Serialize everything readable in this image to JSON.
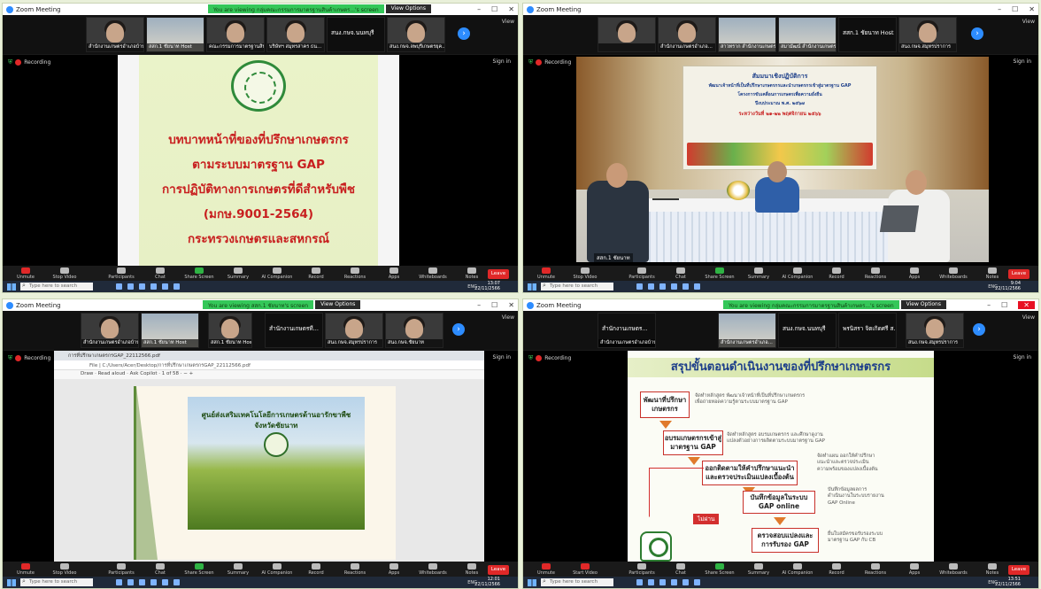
{
  "app_title": "Zoom Meeting",
  "windows": [
    {
      "banner": "You are viewing กลุ่มคณะกรรมการมาตรฐานสินค้าเกษตร...'s screen",
      "view_options": "View Options",
      "tiles": [
        {
          "name": "สำนักงานเกษตรอำเภอบ้าน..."
        },
        {
          "name": "สสก.1 ชัยนาท Host"
        },
        {
          "name": "คณะกรรมการมาตรฐานสินค้า..."
        },
        {
          "name": "บริษัทฯ สมุทรสาคร ธน..."
        },
        {
          "name": "สนง.กษจ.นนทบุรี",
          "label": "สนง.กษจ.นนทบุรี"
        },
        {
          "name": "สนง.กษจ.ลพบุรีเกษตรยุค..."
        }
      ],
      "view": "View",
      "recording": "Recording",
      "sign_in": "Sign in",
      "slide": {
        "line1": "บทบาทหน้าที่ของที่ปรึกษาเกษตรกร",
        "line2": "ตามระบบมาตรฐาน GAP",
        "line3": "การปฏิบัติทางการเกษตรที่ดีสำหรับพืช",
        "line4": "(มกษ.9001-2564)",
        "line5": "กระทรวงเกษตรและสหกรณ์"
      },
      "toolbar": {
        "unmute": "Unmute",
        "stop_video": "Stop Video",
        "participants": "Participants",
        "participants_count": "33",
        "chat": "Chat",
        "share": "Share Screen",
        "summary": "Summary",
        "ai": "AI Companion",
        "record": "Record",
        "reactions": "Reactions",
        "apps": "Apps",
        "whiteboards": "Whiteboards",
        "notes": "Notes",
        "leave": "Leave"
      },
      "taskbar": {
        "search": "Type here to search",
        "time": "13:07",
        "date": "22/11/2566",
        "lang": "ENG"
      }
    },
    {
      "tiles": [
        {
          "name": ""
        },
        {
          "name": "สำนักงานเกษตรอำเภอ..."
        },
        {
          "name": "สาวทราก สำนักงานเกษตร..."
        },
        {
          "name": "สมามัฒน์ สำนักงานเกษตรจังหวัดปทุม"
        },
        {
          "name": "สสก.1 ชัยนาท Host",
          "label": "สสก.1 ชัยนาท Host"
        },
        {
          "name": "สนง.กษจ.สมุทรปราการ"
        }
      ],
      "view": "View",
      "recording": "Recording",
      "sign_in": "Sign in",
      "photo": {
        "banner_line1": "สัมมนาเชิงปฏิบัติการ",
        "banner_line2": "พัฒนาเจ้าหน้าที่เป็นที่ปรึกษาเกษตรกรและนำเกษตรกรเข้าสู่มาตรฐาน GAP",
        "banner_line3": "โครงการขับเคลื่อนการเกษตรเพื่อความยั่งยืน",
        "banner_line4": "ปีงบประมาณ พ.ศ. ๒๕๖๗",
        "banner_line5": "ระหว่างวันที่ ๒๑-๒๒ พฤศจิกายน ๒๕๖๖",
        "nameplate": "สสก.1 ชัยนาท"
      },
      "toolbar": {
        "unmute": "Unmute",
        "stop_video": "Stop Video",
        "participants": "Participants",
        "participants_count": "29",
        "chat": "Chat",
        "share": "Share Screen",
        "summary": "Summary",
        "ai": "AI Companion",
        "record": "Record",
        "reactions": "Reactions",
        "apps": "Apps",
        "whiteboards": "Whiteboards",
        "notes": "Notes",
        "leave": "Leave"
      },
      "taskbar": {
        "search": "Type here to search",
        "time": "9:04",
        "date": "22/11/2566",
        "lang": "ENG"
      }
    },
    {
      "banner": "You are viewing สสก.1 ชัยนาท's screen",
      "view_options": "View Options",
      "tiles": [
        {
          "name": "สำนักงานเกษตรอำเภอบ้าน..."
        },
        {
          "name": "สสก.1 ชัยนาท Host"
        },
        {
          "name": "สสก.1 ชัยนาท Host"
        },
        {
          "name": "สำนักงานเกษตรจังหวัด...",
          "label": "สำนักงานเกษตรที..."
        },
        {
          "name": "สนง.กษจ.สมุทรปราการ"
        },
        {
          "name": "สนง.กษจ.ชัยนาท"
        }
      ],
      "view": "View",
      "recording": "Recording",
      "sign_in": "Sign in",
      "pdf": {
        "tab": "การที่ปรึกษาเกษตรกรGAP_22112566.pdf",
        "url": "File | C:/Users/Acer/Desktop/การที่ปรึกษาเกษตรกรGAP_22112566.pdf",
        "tools": "Draw  ·  Read aloud  ·  Ask Copilot  ·  1 of 58  ·  −  +",
        "page_title1": "ศูนย์ส่งเสริมเทคโนโลยีการเกษตรด้านอารักขาพืช",
        "page_title2": "จังหวัดชัยนาท"
      },
      "toolbar": {
        "unmute": "Unmute",
        "stop_video": "Stop Video",
        "participants": "Participants",
        "participants_count": "31",
        "chat": "Chat",
        "share": "Share Screen",
        "summary": "Summary",
        "ai": "AI Companion",
        "record": "Record",
        "reactions": "Reactions",
        "apps": "Apps",
        "whiteboards": "Whiteboards",
        "notes": "Notes",
        "leave": "Leave"
      },
      "taskbar": {
        "search": "Type here to search",
        "time": "12:01",
        "date": "22/11/2566",
        "lang": "ENG"
      }
    },
    {
      "banner": "You are viewing กลุ่มคณะกรรมการมาตรฐานสินค้าเกษตร...'s screen",
      "view_options": "View Options",
      "tiles": [
        {
          "name": "สำนักงานเกษตรอำเภอบ้าน...",
          "label": "สำนักงานเกษตร..."
        },
        {
          "name": "สำนักงานเกษตรอำเภอ..."
        },
        {
          "name": "สนง.กษจ.นนทบุรี",
          "label": "สนง.กษจ.นนทบุรี"
        },
        {
          "name": "สนง.กษจ.ลพบุรี",
          "label": "พรนิสรา จิตเกิดศรี ส..."
        },
        {
          "name": "สนง.กษจ.สมุทรปราการ"
        }
      ],
      "view": "View",
      "recording": "Recording",
      "sign_in": "Sign in",
      "slide": {
        "title": "สรุปขั้นตอนดำเนินงานของที่ปรึกษาเกษตรกร",
        "step1": "พัฒนาที่ปรึกษาเกษตรกร",
        "step2": "อบรมเกษตรกรเข้าสู่มาตรฐาน GAP",
        "step3": "ออกติดตามให้คำปรึกษาแนะนำและตรวจประเมินแปลงเบื้องต้น",
        "step4": "บันทึกข้อมูลในระบบ GAP online",
        "step5": "ตรวจสอบแปลงและการรับรอง GAP",
        "desc1a": "จัดทำหลักสูตร พัฒนาเจ้าหน้าที่เป็นที่ปรึกษาเกษตรกร",
        "desc1b": "เพื่อถ่ายทอดความรู้ตามระบบมาตรฐาน GAP",
        "desc2a": "จัดทำหลักสูตร อบรมเกษตรกร และศึกษาดูงาน",
        "desc2b": "แปลงตัวอย่างการผลิตตามระบบมาตรฐาน GAP",
        "desc3a": "จัดทำแผน ออกให้คำปรึกษา",
        "desc3b": "แนะนำและตรวจประเมิน",
        "desc3c": "ความพร้อมของแปลงเบื้องต้น",
        "desc4a": "บันทึกข้อมูลผลการ",
        "desc4b": "ดำเนินงานในระบบรายงาน",
        "desc4c": "GAP Online",
        "desc5a": "ยื่นใบสมัครขอรับรองระบบ",
        "desc5b": "มาตรฐาน GAP กับ CB",
        "fail": "ไม่ผ่าน"
      },
      "toolbar": {
        "unmute": "Unmute",
        "stop_video": "Start Video",
        "participants": "Participants",
        "participants_count": "31",
        "chat": "Chat",
        "share": "Share Screen",
        "summary": "Summary",
        "ai": "AI Companion",
        "record": "Record",
        "reactions": "Reactions",
        "apps": "Apps",
        "whiteboards": "Whiteboards",
        "notes": "Notes",
        "leave": "Leave"
      },
      "taskbar": {
        "search": "Type here to search",
        "time": "13:51",
        "date": "22/11/2566",
        "lang": "ENG"
      }
    }
  ]
}
